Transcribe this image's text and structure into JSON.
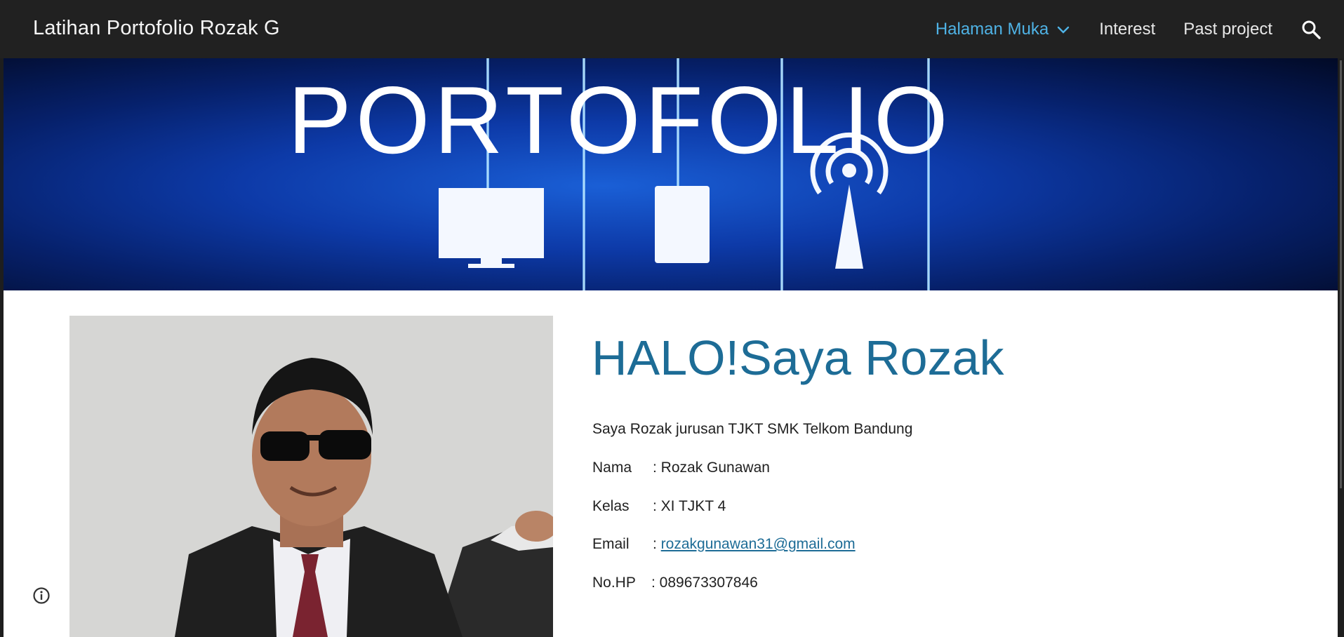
{
  "header": {
    "site_title": "Latihan Portofolio Rozak G",
    "nav": [
      {
        "label": "Halaman Muka",
        "active": true
      },
      {
        "label": "Interest",
        "active": false
      },
      {
        "label": "Past project",
        "active": false
      }
    ],
    "search_icon": "search-icon",
    "dropdown_icon": "chevron-down-icon"
  },
  "banner": {
    "title": "PORTOFOLIO"
  },
  "profile": {
    "heading": "HALO!Saya Rozak",
    "intro": "Saya Rozak jurusan TJKT SMK Telkom Bandung",
    "fields": [
      {
        "label": "Nama",
        "value": ": Rozak Gunawan"
      },
      {
        "label": "Kelas",
        "value": ": XI TJKT 4"
      },
      {
        "label": "Email",
        "prefix": ": ",
        "value": "rozakgunawan31@gmail.com"
      },
      {
        "label": "No.HP",
        "value": ": 089673307846"
      }
    ]
  },
  "footer": {
    "info_icon": "info-icon"
  },
  "colors": {
    "topbar": "#212121",
    "nav_active": "#4fb3e6",
    "heading": "#1d6c96",
    "link": "#1d6c96"
  }
}
